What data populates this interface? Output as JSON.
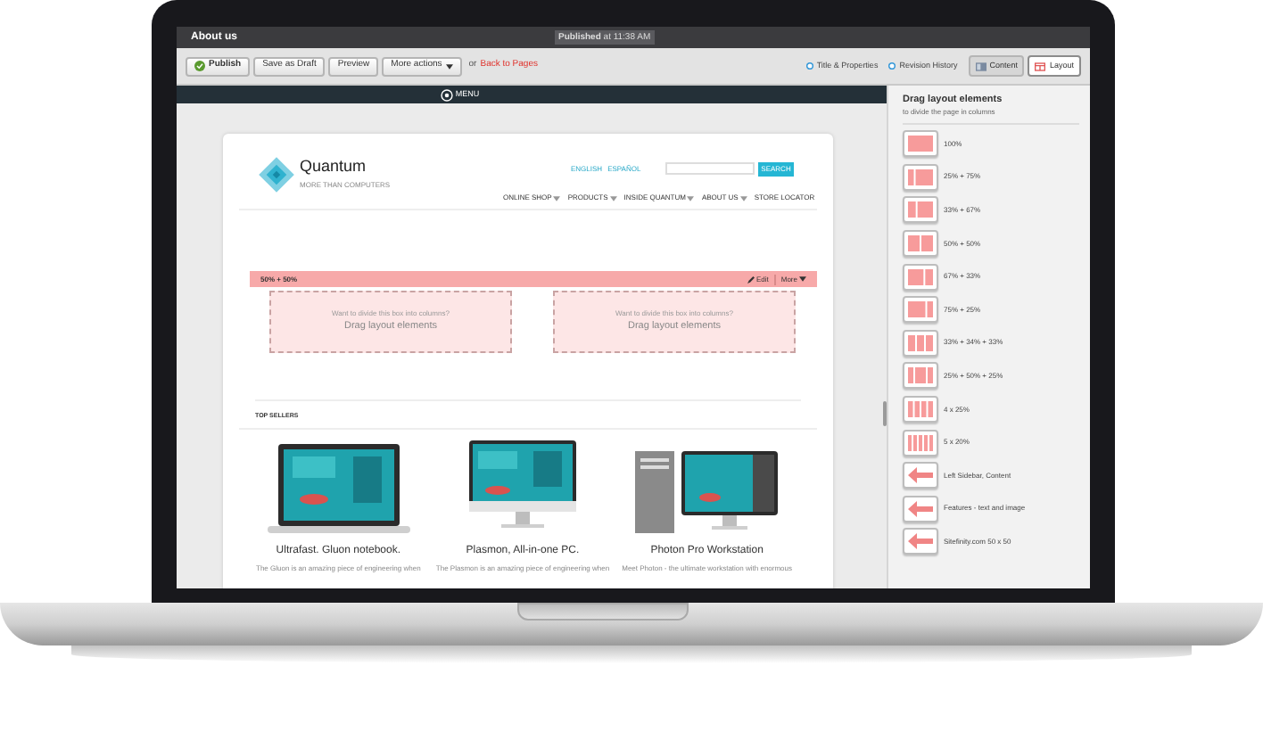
{
  "window": {
    "title": "About us",
    "status": "**Published** at 11:38 AM"
  },
  "toolbar": {
    "buttons": [
      {
        "label": "Publish",
        "kind": "publish"
      },
      {
        "label": "Save as Draft",
        "kind": "plain"
      },
      {
        "label": "Preview",
        "kind": "plain"
      },
      {
        "label": "More actions",
        "kind": "dropdown"
      }
    ],
    "or": "or",
    "back_link": "Back to Pages",
    "panels": [
      {
        "label": "Title & Properties"
      },
      {
        "label": "Revision History"
      }
    ],
    "views": [
      {
        "label": "Content",
        "selected": false
      },
      {
        "label": "Layout",
        "selected": true
      }
    ]
  },
  "menu": {
    "label": "MENU"
  },
  "site": {
    "name": "Quantum",
    "tagline": "MORE THAN COMPUTERS",
    "languages": [
      "ENGLISH",
      "ESPAÑOL"
    ],
    "search_button": "SEARCH",
    "nav": [
      {
        "label": "ONLINE SHOP",
        "dropdown": true
      },
      {
        "label": "PRODUCTS",
        "dropdown": true
      },
      {
        "label": "INSIDE QUANTUM",
        "dropdown": true
      },
      {
        "label": "ABOUT US",
        "dropdown": true
      },
      {
        "label": "STORE LOCATOR",
        "dropdown": false
      }
    ]
  },
  "layout_row": {
    "label": "50% + 50%",
    "edit": "Edit",
    "more": "More",
    "placeholders": [
      {
        "hint": "Want to divide this box into columns?",
        "action": "Drag layout elements"
      },
      {
        "hint": "Want to divide this box into columns?",
        "action": "Drag layout elements"
      }
    ]
  },
  "section_title": "TOP SELLERS",
  "products": [
    {
      "title": "Ultrafast. Gluon notebook.",
      "description": "The Gluon is an amazing piece of engineering when"
    },
    {
      "title": "Plasmon, All-in-one PC.",
      "description": "The Plasmon is an amazing piece of engineering when"
    },
    {
      "title": "Photon Pro Workstation",
      "description": "Meet Photon - the ultimate workstation with enormous"
    }
  ],
  "sidebar": {
    "title": "Drag layout elements",
    "subtitle": "to divide the page in columns",
    "items": [
      {
        "label": "100%",
        "kind": "columns"
      },
      {
        "label": "25% + 75%",
        "kind": "columns"
      },
      {
        "label": "33% + 67%",
        "kind": "columns"
      },
      {
        "label": "50% + 50%",
        "kind": "columns"
      },
      {
        "label": "67% + 33%",
        "kind": "columns"
      },
      {
        "label": "75% + 25%",
        "kind": "columns"
      },
      {
        "label": "33% + 34% + 33%",
        "kind": "columns"
      },
      {
        "label": "25% + 50% + 25%",
        "kind": "columns"
      },
      {
        "label": "4 x 25%",
        "kind": "columns"
      },
      {
        "label": "5 x 20%",
        "kind": "columns"
      },
      {
        "label": "Left Sidebar, Content",
        "kind": "widget"
      },
      {
        "label": "Features - text and image",
        "kind": "widget"
      },
      {
        "label": "Sitefinity.com 50 x 50",
        "kind": "widget"
      }
    ]
  }
}
